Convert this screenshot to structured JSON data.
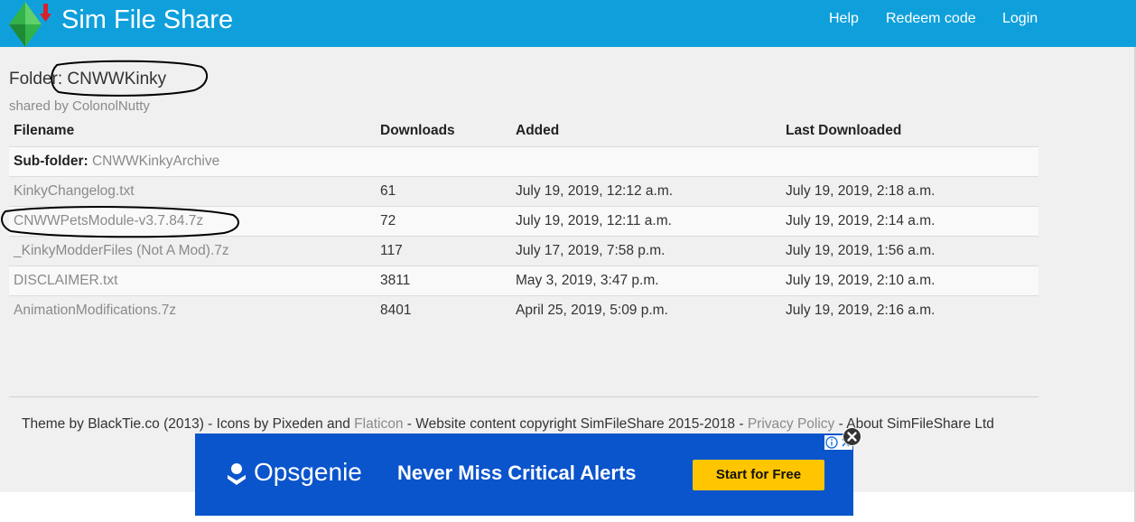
{
  "header": {
    "brand": "Sim File Share",
    "nav": [
      {
        "label": "Help"
      },
      {
        "label": "Redeem code"
      },
      {
        "label": "Login"
      }
    ]
  },
  "folder": {
    "title": "Folder: CNWWKinky",
    "owner": "shared by ColonolNutty"
  },
  "table": {
    "headers": [
      "Filename",
      "Downloads",
      "Added",
      "Last Downloaded"
    ],
    "subfolder": {
      "label": "Sub-folder:",
      "name": "CNWWKinkyArchive"
    },
    "rows": [
      {
        "filename": "KinkyChangelog.txt",
        "downloads": "61",
        "added": "July 19, 2019, 12:12 a.m.",
        "last": "July 19, 2019, 2:18 a.m."
      },
      {
        "filename": "CNWWPetsModule-v3.7.84.7z",
        "downloads": "72",
        "added": "July 19, 2019, 12:11 a.m.",
        "last": "July 19, 2019, 2:14 a.m."
      },
      {
        "filename": "_KinkyModderFiles (Not A Mod).7z",
        "downloads": "117",
        "added": "July 17, 2019, 7:58 p.m.",
        "last": "July 19, 2019, 1:56 a.m."
      },
      {
        "filename": "DISCLAIMER.txt",
        "downloads": "3811",
        "added": "May 3, 2019, 3:47 p.m.",
        "last": "July 19, 2019, 2:10 a.m."
      },
      {
        "filename": "AnimationModifications.7z",
        "downloads": "8401",
        "added": "April 25, 2019, 5:09 p.m.",
        "last": "July 19, 2019, 2:16 a.m."
      }
    ]
  },
  "footer": {
    "part1": "Theme by BlackTie.co (2013) - Icons by Pixeden and ",
    "flaticon": "Flaticon",
    "part2": " - Website content copyright SimFileShare 2015-2018 - ",
    "privacy": "Privacy Policy",
    "part3": " - About SimFileShare Ltd"
  },
  "ad": {
    "brand": "Opsgenie",
    "headline": "Never Miss Critical Alerts",
    "cta": "Start for Free",
    "info_glyph": "ⓘ",
    "x_glyph": "✕"
  },
  "colors": {
    "navbar": "#0fa0dc",
    "ad_background": "#0a54cc",
    "ad_cta": "#ffc500",
    "annotation": "#000000"
  },
  "icons": {
    "logo": "plumbob-download-icon",
    "ad_logo": "opsgenie-icon",
    "ad_info": "info-icon",
    "ad_close": "close-icon"
  }
}
